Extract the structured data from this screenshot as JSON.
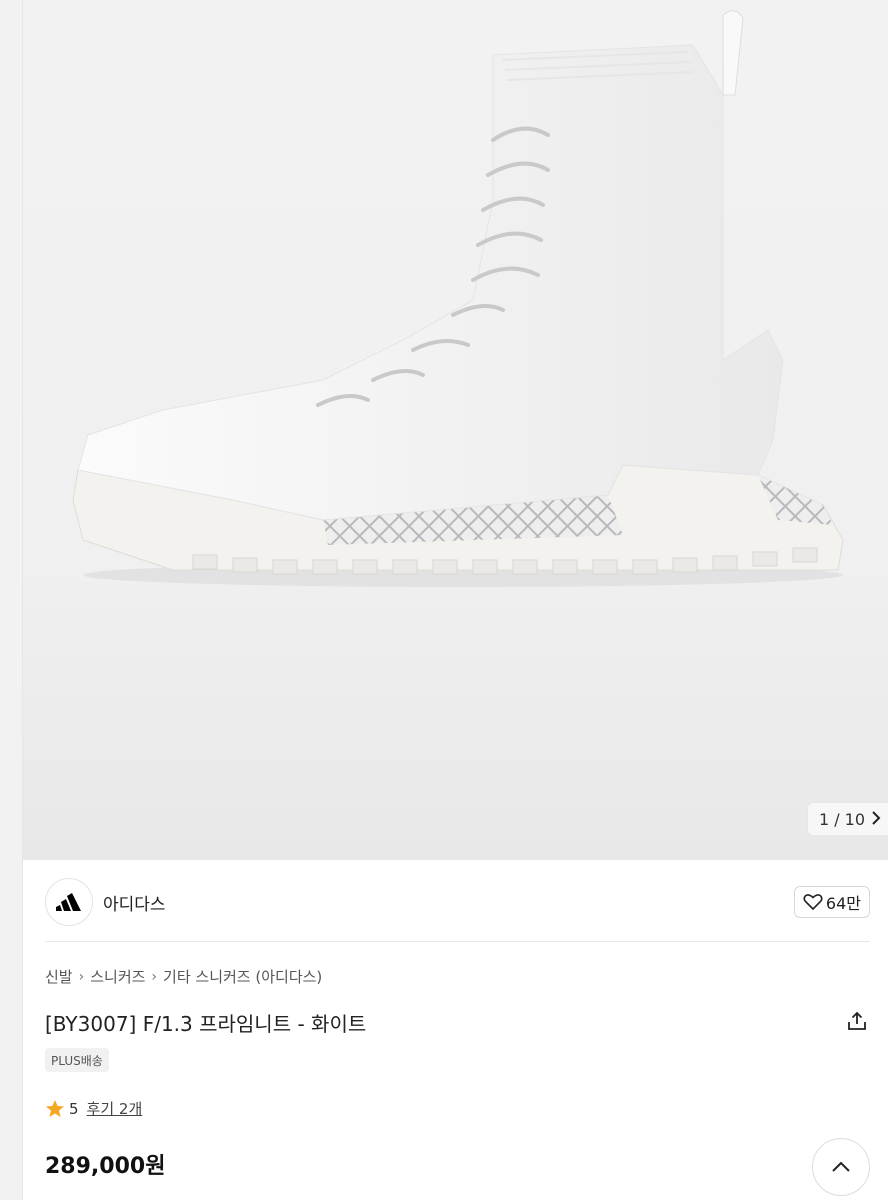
{
  "gallery": {
    "counter": "1 / 10",
    "next_icon": "chevron-right-icon"
  },
  "brand": {
    "name": "아디다스",
    "logo": "adidas-logo",
    "likes": "64만",
    "like_icon": "heart-icon"
  },
  "breadcrumb": [
    "신발",
    "스니커즈",
    "기타 스니커즈 (아디다스)"
  ],
  "product": {
    "title": "[BY3007] F/1.3 프라임니트 - 화이트",
    "badge": "PLUS배송",
    "rating": "5",
    "reviews": "후기 2개",
    "price": "289,000원"
  },
  "icons": {
    "share": "share-icon",
    "scroll_top": "chevron-up-icon",
    "star": "star-icon"
  },
  "colors": {
    "star": "#f5a623",
    "background": "#ffffff",
    "gallery_bg": "#f0f0f0"
  }
}
